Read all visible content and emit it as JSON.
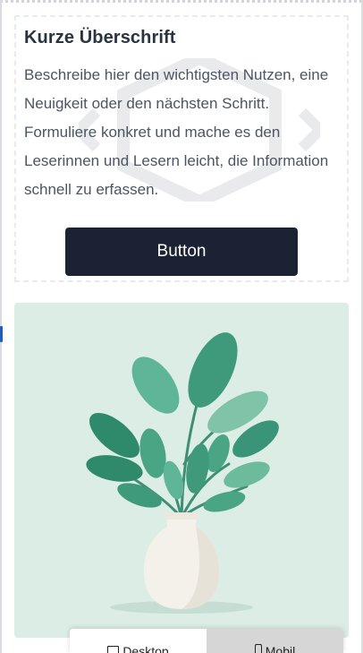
{
  "content": {
    "heading": "Kurze Überschrift",
    "body": "Beschreibe hier den wichtigsten Nutzen, eine Neuigkeit oder den nächsten Schritt. Formuliere konkret und mache es den Leserinnen und Lesern leicht, die Information schnell zu erfassen.",
    "button_label": "Button"
  },
  "image": {
    "icon": "plant-vase-illustration",
    "background_color": "#dcede6"
  },
  "view_toggle": {
    "desktop_label": "Desktop",
    "mobile_label": "Mobil",
    "active": "desktop",
    "desktop_icon": "monitor-icon",
    "mobile_icon": "phone-icon"
  },
  "colors": {
    "button_bg": "#1b2233",
    "heading": "#2a3340",
    "body_text": "#4b5563",
    "leaf": "#3f9a7c"
  }
}
